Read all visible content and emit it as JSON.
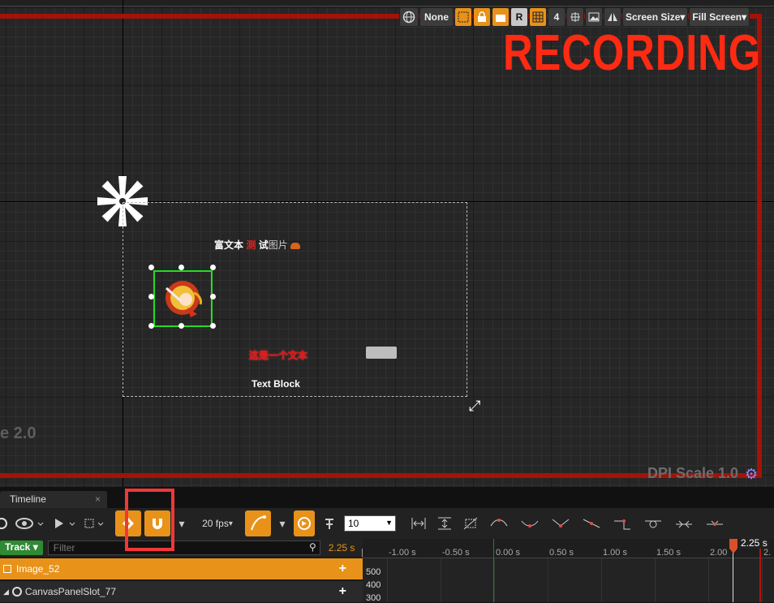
{
  "viewport": {
    "recording_label": "RECORDING",
    "dpi_label": "DPI Scale 1.0",
    "scale_left_label": "e 2.0",
    "toolbar": {
      "none_label": "None",
      "r_label": "R",
      "grid_number": "4",
      "screen_size": "Screen Size",
      "fill_screen": "Fill Screen"
    },
    "rich_text": {
      "part1": "富文本 ",
      "part2": "测",
      "part3": " 试",
      "part4": "图片"
    },
    "red_text": "这是一个文本",
    "text_block": "Text Block"
  },
  "timeline": {
    "tab_label": "Timeline",
    "fps": "20 fps",
    "snap_value": "10",
    "track_button": "Track",
    "filter_placeholder": "Filter",
    "current_time_small": "2.25 s",
    "rows": [
      {
        "label": "Image_52"
      },
      {
        "label": "CanvasPanelSlot_77"
      }
    ],
    "ruler_ticks": [
      "-1.00 s",
      "-0.50 s",
      "0.00 s",
      "0.50 s",
      "1.00 s",
      "1.50 s",
      "2.00",
      "2."
    ],
    "playhead_label": "2.25 s",
    "y_values": [
      "500",
      "400",
      "300"
    ]
  },
  "colors": {
    "accent": "#e8921a",
    "recording": "#ff2a12",
    "selection": "#22dd22"
  }
}
